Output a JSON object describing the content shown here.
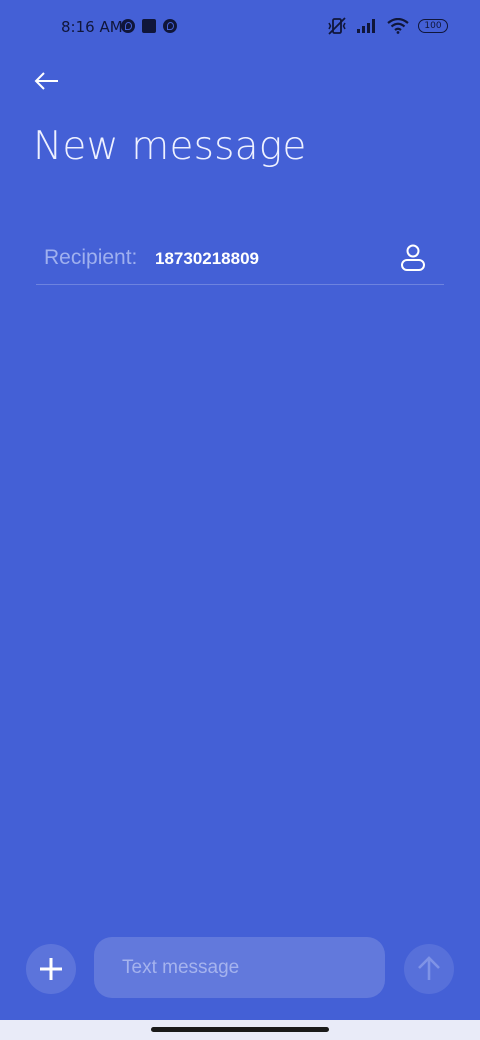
{
  "status_bar": {
    "time": "8:16 AM",
    "battery": "100"
  },
  "header": {
    "back_icon": "arrow-left-icon",
    "title": "New message"
  },
  "recipient": {
    "label": "Recipient:",
    "value": "18730218809",
    "contact_icon": "person-icon"
  },
  "composer": {
    "add_icon": "plus-icon",
    "placeholder": "Text message",
    "send_icon": "arrow-up-icon"
  },
  "colors": {
    "background": "#4460d6",
    "status_foreground": "#10163a",
    "muted_text": "#9fb0ef"
  }
}
